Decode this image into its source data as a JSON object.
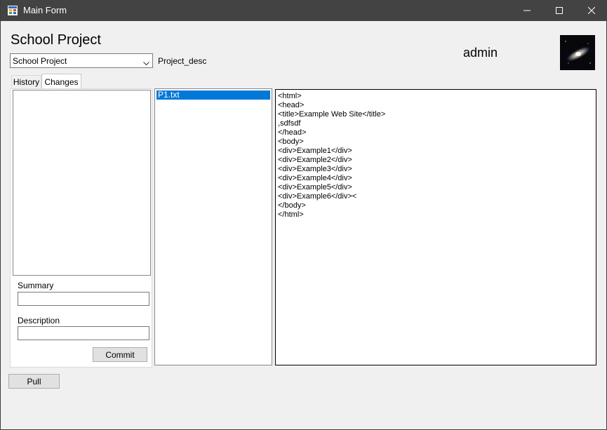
{
  "window": {
    "title": "Main Form"
  },
  "header": {
    "project_title": "School Project",
    "project_select_value": "School Project",
    "project_desc": "Project_desc",
    "username": "admin"
  },
  "tabs": [
    {
      "label": "History",
      "selected": false
    },
    {
      "label": "Changes",
      "selected": true
    }
  ],
  "changes_panel": {
    "summary_label": "Summary",
    "summary_value": "",
    "description_label": "Description",
    "description_value": "",
    "commit_label": "Commit"
  },
  "files": [
    {
      "name": "P1.txt",
      "selected": true
    }
  ],
  "editor": {
    "lines": [
      "<html>",
      "<head>",
      "<title>Example Web Site</title>",
      ",sdfsdf",
      "</head>",
      "<body>",
      "<div>Example1</div>",
      "<div>Example2</div>",
      "<div>Example3</div>",
      "<div>Example4</div>",
      "<div>Example5</div>",
      "<div>Example6</div><",
      "</body>",
      "</html>"
    ]
  },
  "footer": {
    "pull_label": "Pull"
  },
  "icons": {
    "app": "app-icon",
    "minimize": "minimize-icon",
    "maximize": "maximize-icon",
    "close": "close-icon",
    "dropdown": "chevron-down-icon",
    "avatar": "galaxy-avatar"
  },
  "colors": {
    "titlebar": "#434343",
    "selection": "#0078d7",
    "window_bg": "#f0f0f0"
  }
}
